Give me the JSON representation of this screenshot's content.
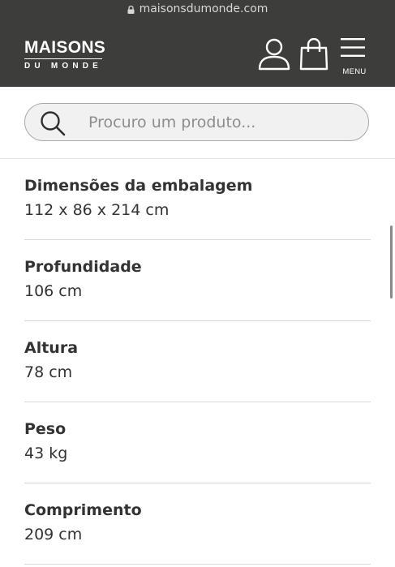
{
  "browser": {
    "url": "maisonsdumonde.com"
  },
  "header": {
    "logo_line1": "MAISONS",
    "logo_line2": "DU MONDE",
    "menu_label": "MENU"
  },
  "search": {
    "placeholder": "Procuro um produto..."
  },
  "specs": [
    {
      "label": "Dimensões da embalagem",
      "value": "112 x 86 x 214 cm"
    },
    {
      "label": "Profundidade",
      "value": "106 cm"
    },
    {
      "label": "Altura",
      "value": "78 cm"
    },
    {
      "label": "Peso",
      "value": "43 kg"
    },
    {
      "label": "Comprimento",
      "value": "209 cm"
    }
  ],
  "colors": {
    "header_bg": "#3d3d3b",
    "text": "#333333",
    "divider": "#d7d7d7"
  },
  "icons": [
    "lock-icon",
    "user-icon",
    "shopping-bag-icon",
    "hamburger-menu-icon",
    "search-icon"
  ]
}
